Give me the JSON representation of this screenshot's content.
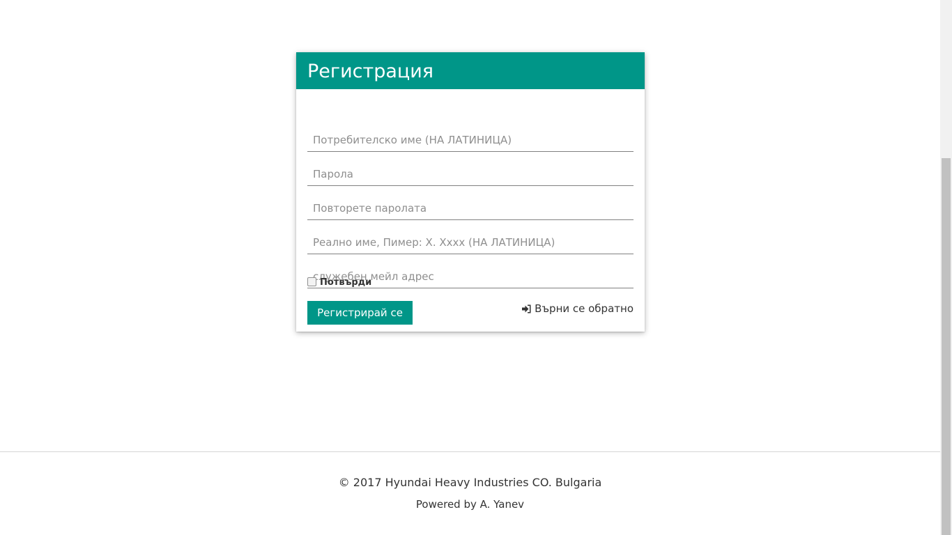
{
  "register_card": {
    "title": "Регистрация",
    "fields": [
      {
        "placeholder": "Потребителско име (НА ЛАТИНИЦА)",
        "value": ""
      },
      {
        "placeholder": "Парола",
        "value": ""
      },
      {
        "placeholder": "Повторете паролата",
        "value": ""
      },
      {
        "placeholder": "Реално име, Пимер: X. Xxxx (НА ЛАТИНИЦА)",
        "value": ""
      },
      {
        "placeholder": "служебен мейл адрес",
        "value": ""
      }
    ],
    "confirm_label": "Потвърди",
    "confirm_checked": false,
    "register_button": "Регистрирай се",
    "back_link": "Върни се обратно",
    "back_icon": "sign-in-icon"
  },
  "footer": {
    "copyright": "© 2017 Hyundai Heavy Industries CO. Bulgaria",
    "powered_by": "Powered by A. Yanev"
  },
  "colors": {
    "accent": "#009688",
    "text": "#333333",
    "divider": "#d6d6d6"
  }
}
